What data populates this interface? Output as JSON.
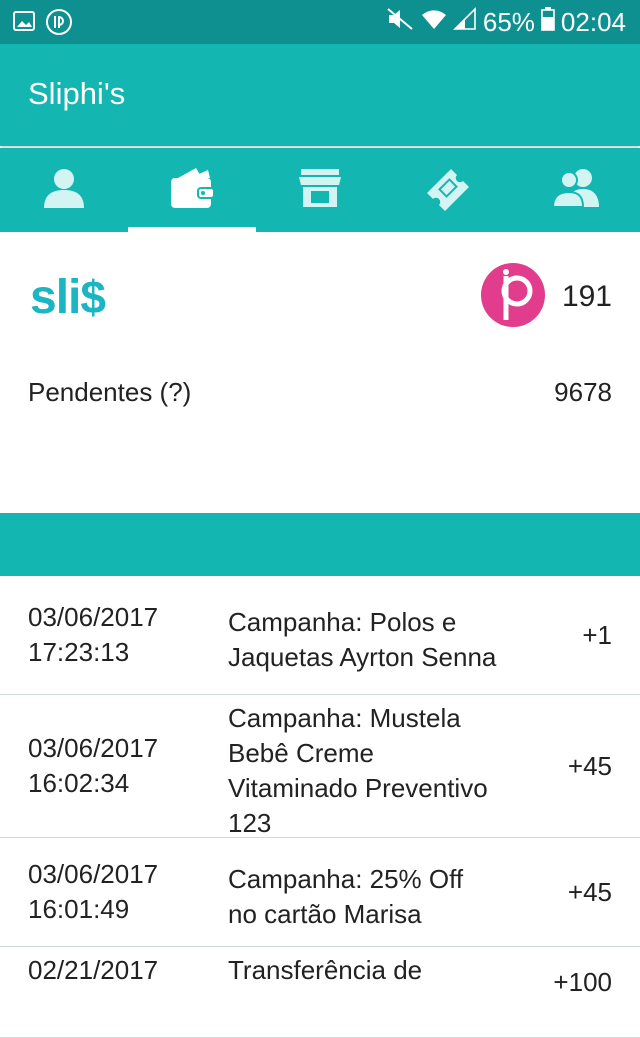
{
  "status_bar": {
    "battery": "65%",
    "time": "02:04"
  },
  "app": {
    "title": "Sliphi's"
  },
  "tabs": [
    {
      "icon": "profile-icon"
    },
    {
      "icon": "wallet-icon"
    },
    {
      "icon": "store-icon"
    },
    {
      "icon": "ticket-icon"
    },
    {
      "icon": "group-icon"
    }
  ],
  "summary": {
    "brand": "slis",
    "points": "191",
    "pending_label": "Pendentes (?)",
    "pending_value": "9678"
  },
  "transactions": [
    {
      "date": "03/06/2017",
      "time": "17:23:13",
      "description": "Campanha: Polos e Jaquetas Ayrton Senna",
      "amount": "+1"
    },
    {
      "date": "03/06/2017",
      "time": "16:02:34",
      "description": "Campanha: Mustela Bebê Creme Vitaminado Preventivo 123",
      "amount": "+45"
    },
    {
      "date": "03/06/2017",
      "time": "16:01:49",
      "description": "Campanha: 25% Off no cartão Marisa",
      "amount": "+45"
    },
    {
      "date": "02/21/2017",
      "time": "",
      "description": "Transferência de",
      "amount": "+100"
    }
  ],
  "colors": {
    "primary": "#14b6b2",
    "status_bar": "#0e9090",
    "brand": "#1bb5c4",
    "badge": "#e23c8c"
  }
}
